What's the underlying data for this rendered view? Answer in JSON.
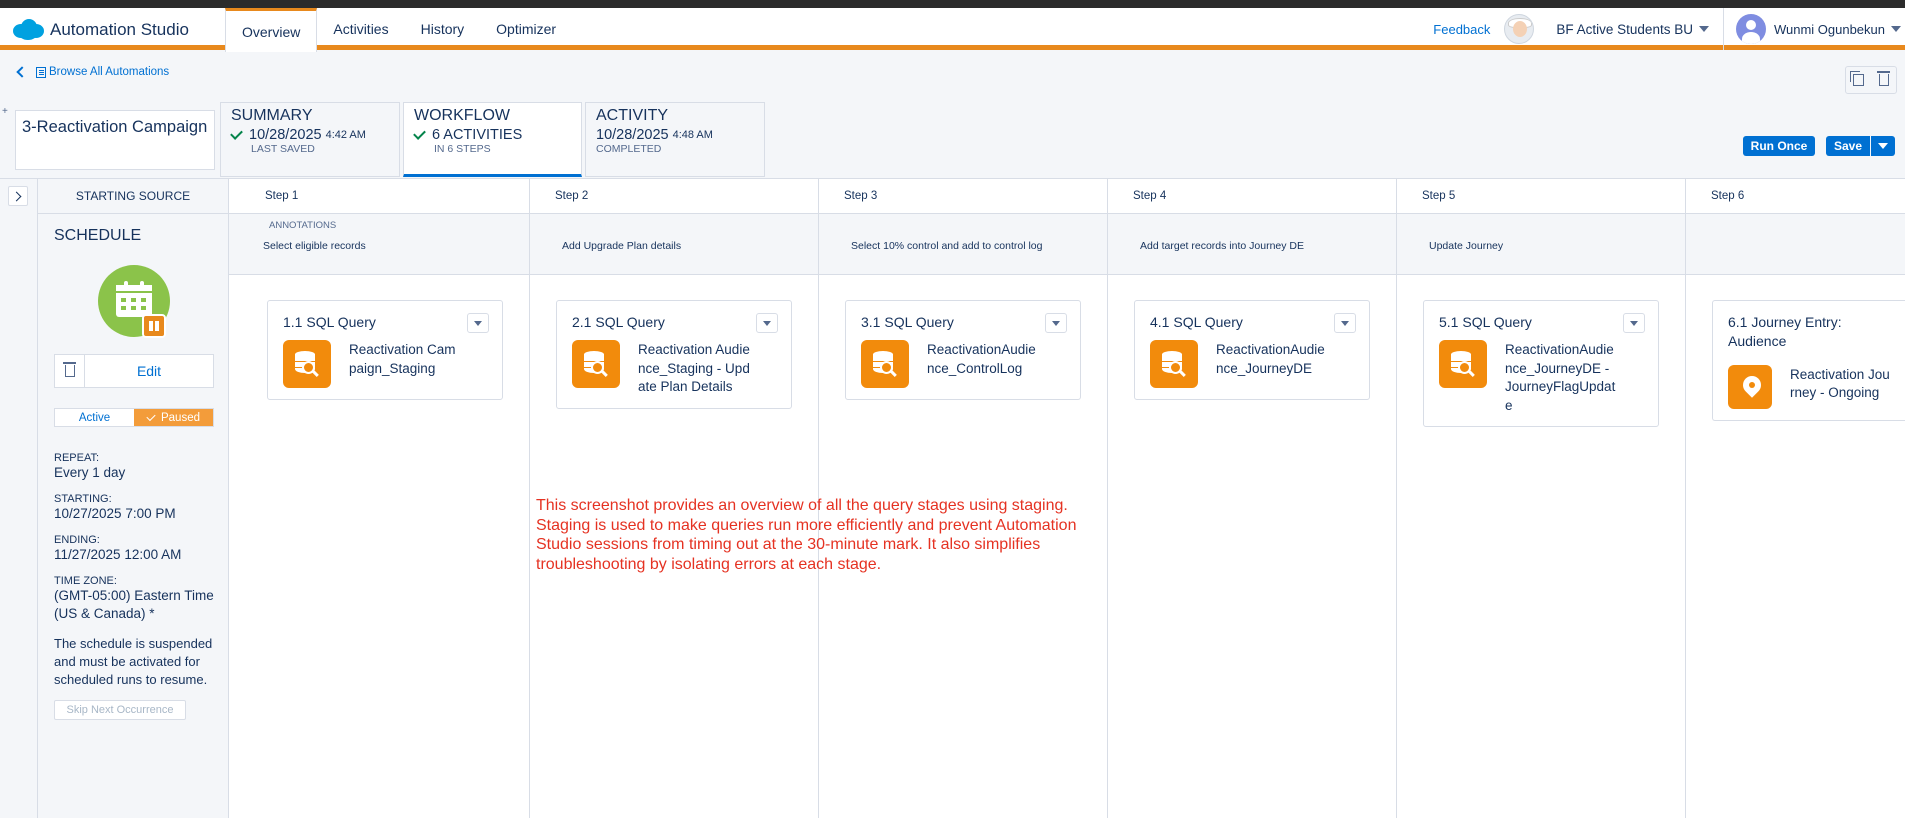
{
  "app": {
    "name": "Automation Studio",
    "nav_tabs": [
      "Overview",
      "Activities",
      "History",
      "Optimizer"
    ],
    "active_tab": "Overview",
    "feedback": "Feedback",
    "business_unit": "BF Active Students BU",
    "user": "Wunmi Ogunbekun",
    "brand_color": "#e8891d",
    "accent_color": "#0070d2"
  },
  "breadcrumb": "Browse All Automations",
  "automation": {
    "name": "3-Reactivation Campaign",
    "summary": {
      "title": "SUMMARY",
      "date": "10/28/2025",
      "time": "4:42 AM",
      "sub": "LAST SAVED"
    },
    "workflow": {
      "title": "WORKFLOW",
      "main": "6 ACTIVITIES",
      "sub": "IN 6 STEPS"
    },
    "activity": {
      "title": "ACTIVITY",
      "date": "10/28/2025",
      "time": "4:48 AM",
      "sub": "COMPLETED"
    }
  },
  "buttons": {
    "run_once": "Run Once",
    "save": "Save"
  },
  "source": {
    "header": "STARTING SOURCE",
    "title": "SCHEDULE",
    "edit": "Edit",
    "toggle": {
      "active": "Active",
      "paused": "Paused",
      "selected": "Paused"
    },
    "repeat_label": "REPEAT:",
    "repeat": "Every 1 day",
    "starting_label": "STARTING:",
    "starting": "10/27/2025 7:00 PM",
    "ending_label": "ENDING:",
    "ending": "11/27/2025 12:00 AM",
    "tz_label": "TIME ZONE:",
    "tz": "(GMT-05:00) Eastern Time (US & Canada) *",
    "note": "The schedule is suspended and must be activated for scheduled runs to resume.",
    "skip": "Skip Next Occurrence"
  },
  "annotations_label": "ANNOTATIONS",
  "steps": [
    {
      "label": "Step 1",
      "annotation": "Select eligible records",
      "activity_title": "1.1 SQL Query",
      "activity_name": "Reactivation Campaign_Staging",
      "icon": "sql-query-icon"
    },
    {
      "label": "Step 2",
      "annotation": "Add Upgrade Plan details",
      "activity_title": "2.1 SQL Query",
      "activity_name": "Reactivation Audience_Staging - Update Plan Details",
      "icon": "sql-query-icon"
    },
    {
      "label": "Step 3",
      "annotation": "Select 10% control and add to control log",
      "activity_title": "3.1 SQL Query",
      "activity_name": "ReactivationAudience_ControlLog",
      "icon": "sql-query-icon"
    },
    {
      "label": "Step 4",
      "annotation": "Add target records into Journey DE",
      "activity_title": "4.1 SQL Query",
      "activity_name": "ReactivationAudience_JourneyDE",
      "icon": "sql-query-icon"
    },
    {
      "label": "Step 5",
      "annotation": "Update Journey",
      "activity_title": "5.1 SQL Query",
      "activity_name": "ReactivationAudience_JourneyDE - JourneyFlagUpdate",
      "icon": "sql-query-icon"
    },
    {
      "label": "Step 6",
      "annotation": "",
      "activity_title": "6.1 Journey Entry: Audience",
      "activity_name": "Reactivation Journey - Ongoing",
      "icon": "journey-pin-icon"
    }
  ],
  "overlay_note": "This screenshot provides an overview of all the query stages using staging. Staging is used to make queries run more efficiently and prevent Automation Studio sessions from timing out at the 30-minute mark. It also simplifies troubleshooting by isolating errors at each stage."
}
